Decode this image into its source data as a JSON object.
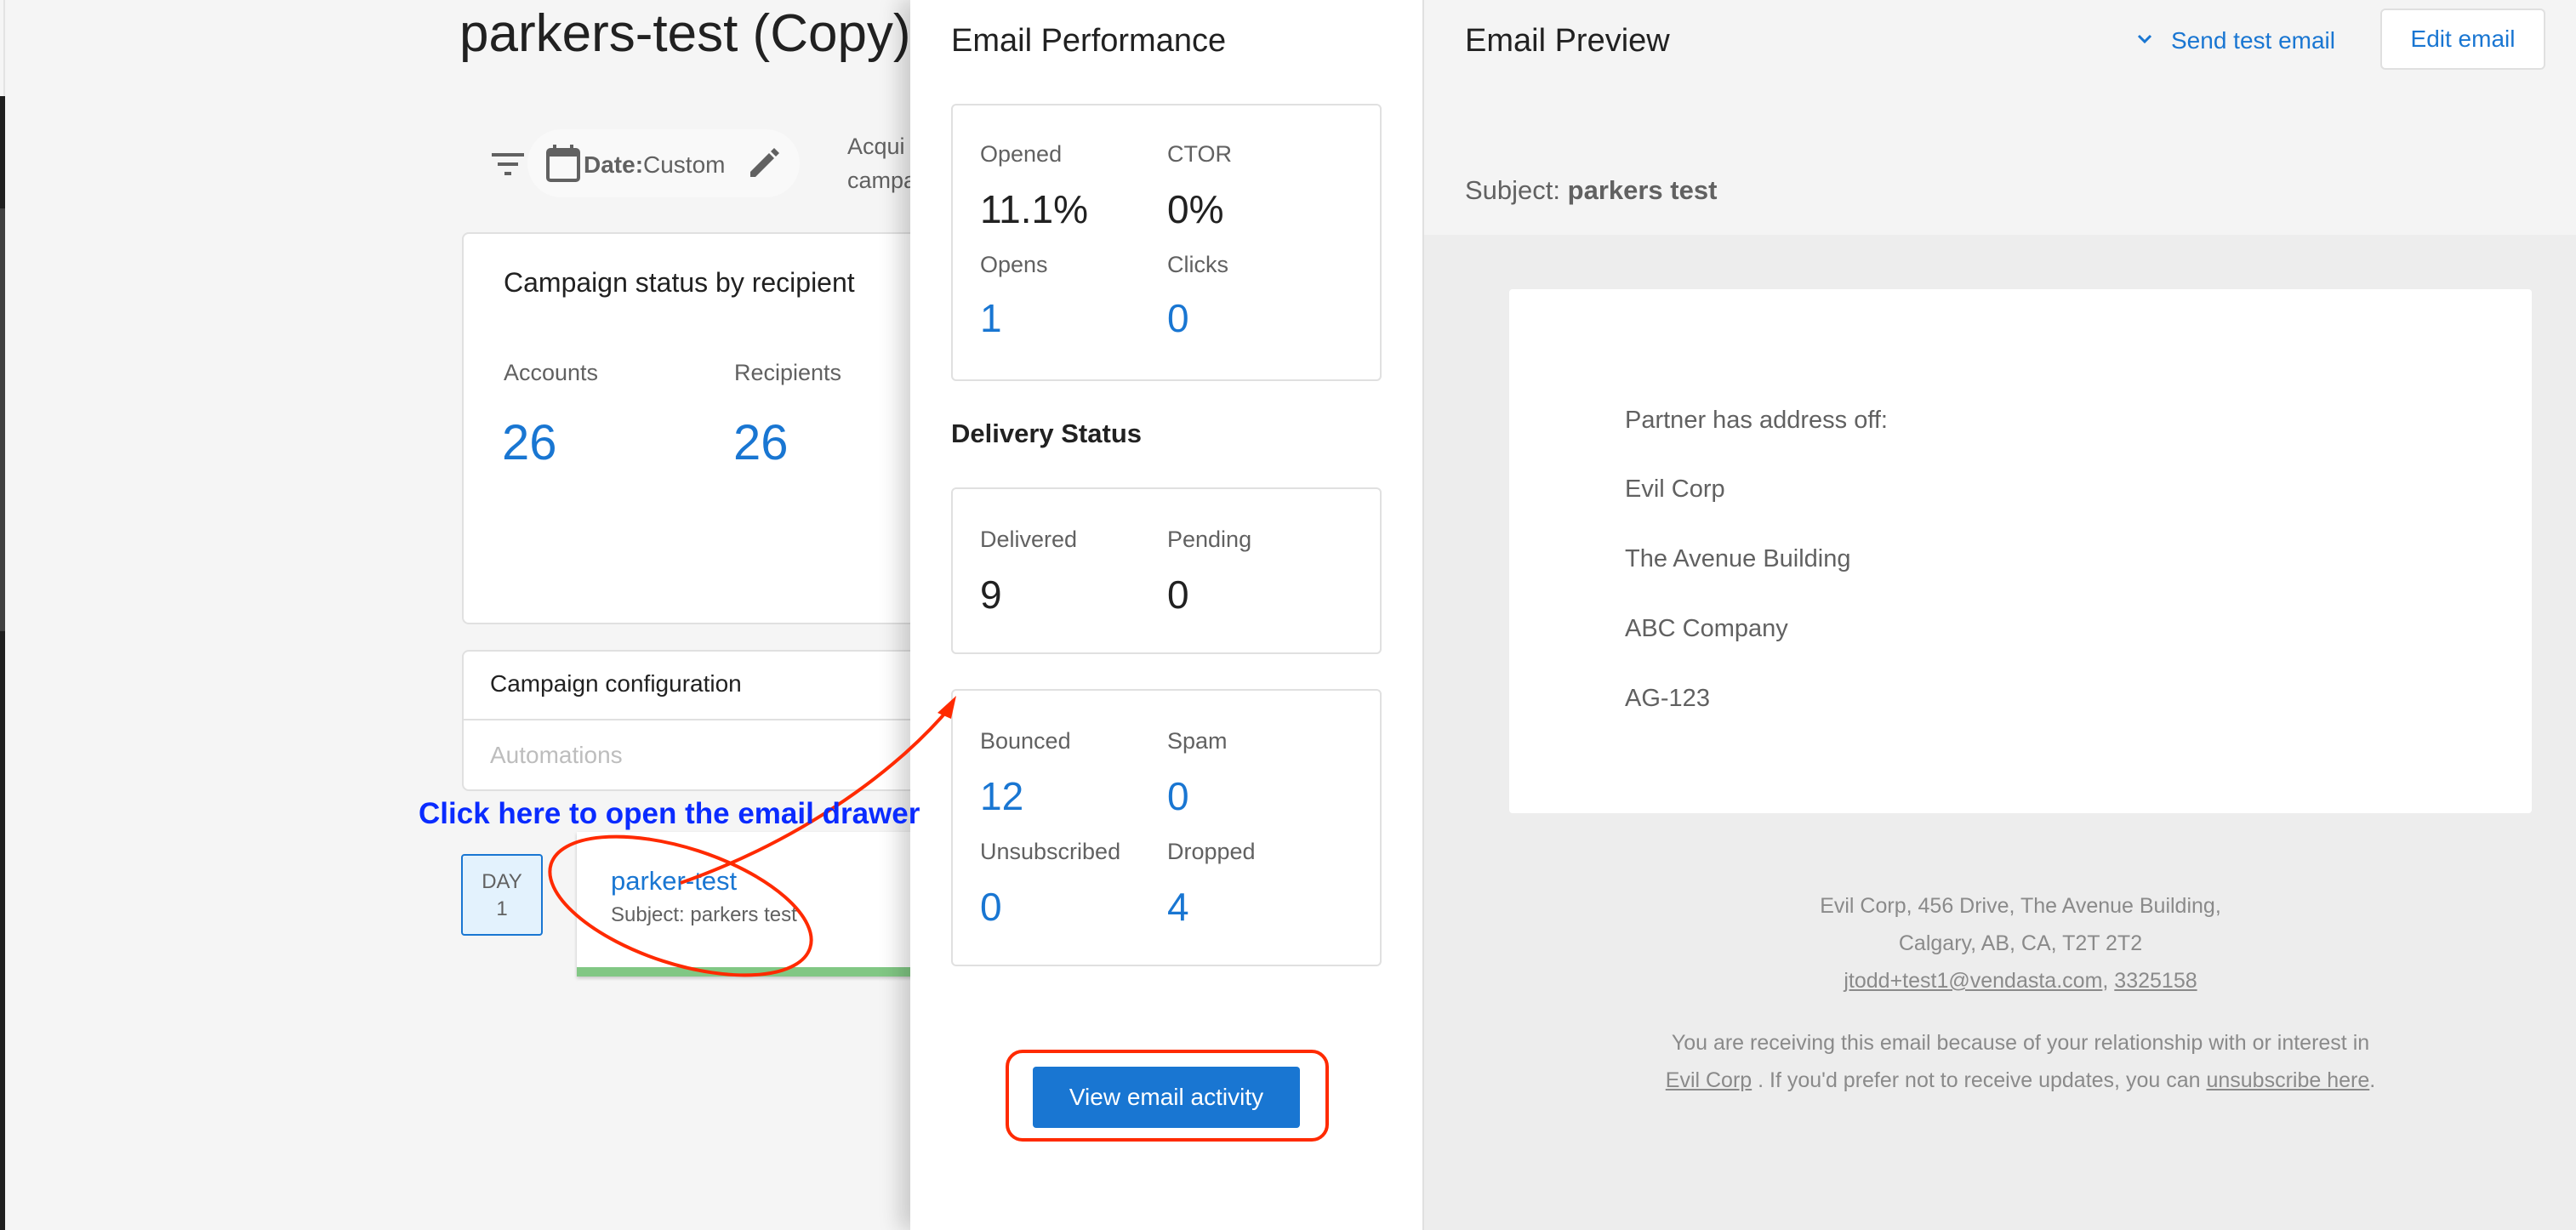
{
  "page": {
    "title": "parkers-test (Copy)",
    "filter": {
      "date_label": "Date:",
      "date_value": "Custom",
      "truncated_text_line1": "Acqui",
      "truncated_text_line2": "campa"
    },
    "campaign_status": {
      "title": "Campaign status by recipient",
      "stats": [
        {
          "label": "Accounts",
          "value": "26"
        },
        {
          "label": "Recipients",
          "value": "26"
        }
      ]
    },
    "campaign_configuration": {
      "title": "Campaign configuration",
      "automations_label": "Automations"
    },
    "step": {
      "day_label": "DAY",
      "day_number": "1",
      "email_name": "parker-test",
      "subject": "Subject: parkers test",
      "status_color": "#81c784"
    }
  },
  "annotation": {
    "text": "Click here to open the email drawer",
    "text_color": "#0a2bff",
    "mark_color": "#ff2a00"
  },
  "drawer": {
    "performance": {
      "title": "Email Performance",
      "metrics": [
        {
          "label": "Opened",
          "value": "11.1%"
        },
        {
          "label": "CTOR",
          "value": "0%"
        },
        {
          "label": "Opens",
          "value": "1"
        },
        {
          "label": "Clicks",
          "value": "0"
        }
      ]
    },
    "delivery_status": {
      "title": "Delivery Status",
      "primary": [
        {
          "label": "Delivered",
          "value": "9"
        },
        {
          "label": "Pending",
          "value": "0"
        }
      ],
      "issues": [
        {
          "label": "Bounced",
          "value": "12"
        },
        {
          "label": "Spam",
          "value": "0"
        },
        {
          "label": "Unsubscribed",
          "value": "0"
        },
        {
          "label": "Dropped",
          "value": "4"
        }
      ]
    },
    "view_activity_button": "View email activity",
    "accent_color": "#1976d2"
  },
  "preview": {
    "title": "Email Preview",
    "send_test_label": "Send test email",
    "edit_label": "Edit email",
    "subject_label": "Subject:",
    "subject_value": "parkers test",
    "body_lines": [
      "Partner has address off:",
      "Evil Corp",
      "The Avenue Building",
      "ABC Company",
      "AG-123"
    ],
    "footer": {
      "address_line1": "Evil Corp, 456 Drive, The Avenue Building,",
      "address_line2": "Calgary, AB, CA, T2T 2T2",
      "email_link": "jtodd+test1@vendasta.com",
      "separator": ",",
      "phone_link": "3325158",
      "notice_prefix": "You are receiving this email because of your relationship with or interest in",
      "company_link": "Evil Corp",
      "notice_middle": ". If you'd prefer not to receive updates, you can",
      "unsubscribe_link": "unsubscribe here",
      "notice_end": "."
    }
  }
}
